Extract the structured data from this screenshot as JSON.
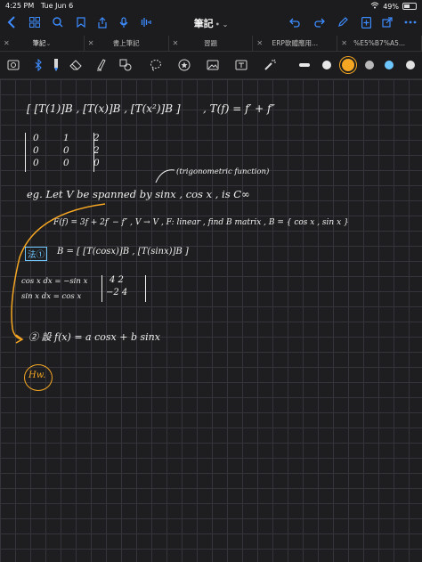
{
  "status_bar": {
    "time": "4:25 PM",
    "date": "Tue Jun 6",
    "battery": "49%"
  },
  "nav": {
    "title": "筆記"
  },
  "tabs": [
    {
      "label": "筆記"
    },
    {
      "label": "書上筆記"
    },
    {
      "label": "習題"
    },
    {
      "label": "ERP軟體應用..."
    },
    {
      "label": "%E5%B7%A5..."
    }
  ],
  "handwriting": {
    "line1": "[ [T(1)]B , [T(x)]B , [T(x²)]B ]",
    "line1b": ", T(f) = f′ + f″",
    "matrix_row1": "0 1 2",
    "matrix_row2": "0 0 2",
    "matrix_row3": "0 0 0",
    "annotation": "(trigonometric function)",
    "line2": "eg. Let V be spanned by sinx , cos x , is C∞",
    "line3": "F(f) = 3f + 2f′ − f″ , V → V , F: linear , find B matrix , B = { cos x , sin x }",
    "label_sol": "法①",
    "line4": "B = [ [T(cosx)]B , [T(sinx)]B ]",
    "line5a": "cos x dx = −sin x",
    "line5b": "sin x dx = cos x",
    "m2_row1": "4  2",
    "m2_row2": "−2  4",
    "line6": "② 設 f(x) = a cosx + b sinx",
    "hw": "Hw."
  },
  "colors": {
    "accent": "#3d8cff",
    "ink": "#f0f0f0",
    "orange": "#f5a623",
    "cyan": "#6ec6ff"
  }
}
